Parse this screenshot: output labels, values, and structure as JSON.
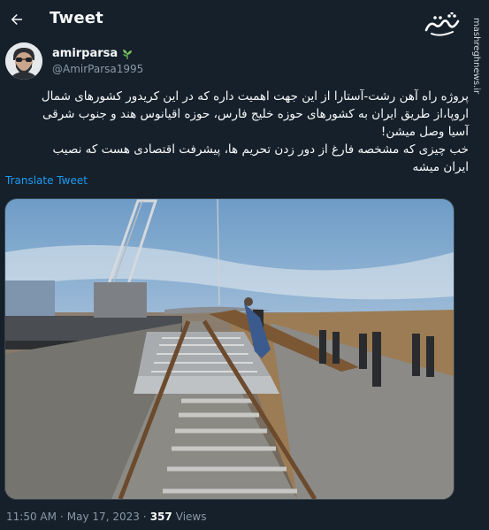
{
  "header": {
    "title": "Tweet",
    "back_icon": "arrow-left-icon"
  },
  "watermark": {
    "logo_text": "مشرق",
    "url": "mashreghnews.ir"
  },
  "author": {
    "display_name": "amirparsa",
    "handle": "@AmirParsa1995",
    "name_emoji_icon": "herb-icon"
  },
  "tweet": {
    "text_line1": "پروژه راه آهن رشت-آستارا از این جهت اهمیت داره که در این کریدور کشورهای شمال",
    "text_line2": "اروپا،از طریق ایران به کشورهای حوزه خلیج فارس، حوزه اقیانوس هند و جنوب شرقی",
    "text_line3": "آسیا وصل میشن!",
    "text_line4": "خب چیزی که مشخصه فارغ از دور زدن تحریم ها، پیشرفت اقتصادی هست که نصیب",
    "text_line5": "ایران میشه",
    "translate_label": "Translate Tweet"
  },
  "meta": {
    "time": "11:50 AM",
    "separator1": "·",
    "date": "May 17, 2023",
    "separator2": "·",
    "views_count": "357",
    "views_label": "Views"
  },
  "colors": {
    "background": "#15202b",
    "text": "#f7f9f9",
    "secondary": "#8b98a5",
    "link": "#1d9bf0"
  }
}
